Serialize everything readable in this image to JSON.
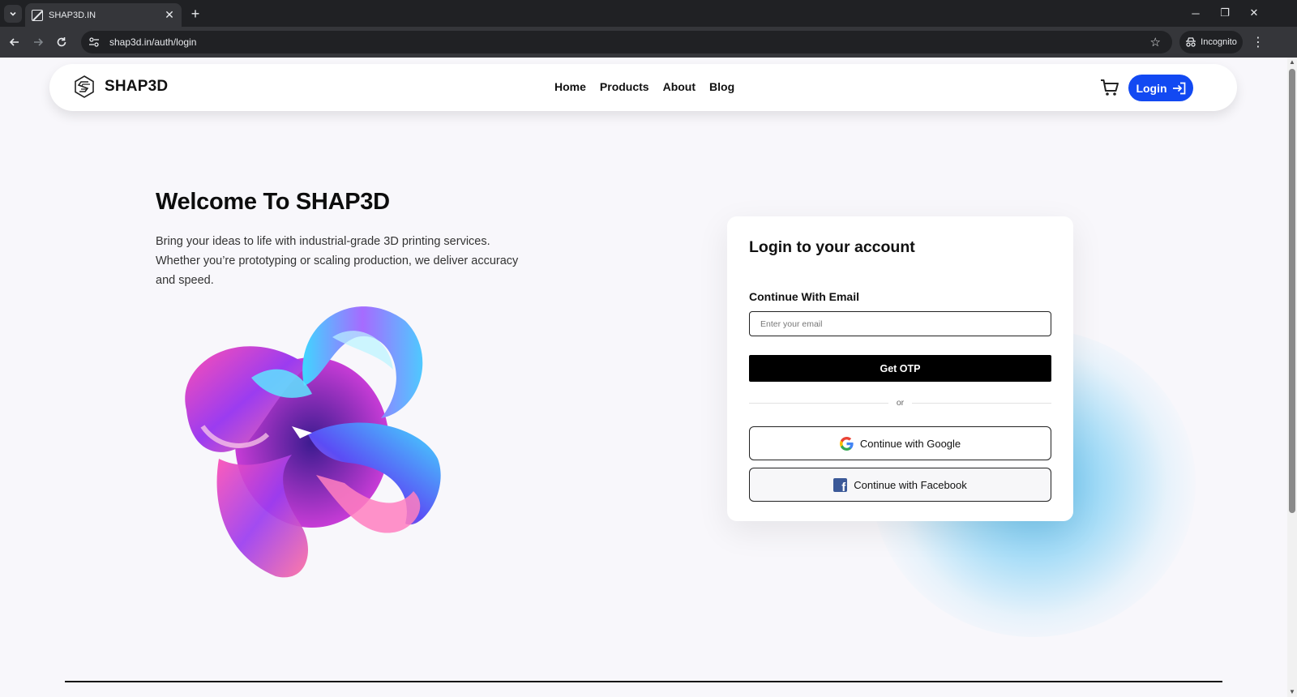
{
  "browser": {
    "tab_title": "SHAP3D.IN",
    "url": "shap3d.in/auth/login",
    "incognito_label": "Incognito"
  },
  "nav": {
    "brand": "SHAP3D",
    "links": [
      "Home",
      "Products",
      "About",
      "Blog"
    ],
    "login_label": "Login",
    "accent_color": "#1249f2"
  },
  "hero": {
    "title": "Welcome To SHAP3D",
    "description": "Bring your ideas to life with industrial-grade 3D printing services. Whether you’re prototyping or scaling production, we deliver accuracy and speed."
  },
  "login_card": {
    "title": "Login to your account",
    "email_label": "Continue With Email",
    "email_placeholder": "Enter your email",
    "email_value": "",
    "otp_button": "Get OTP",
    "divider_text": "or",
    "google_button": "Continue with Google",
    "facebook_button": "Continue with Facebook"
  }
}
